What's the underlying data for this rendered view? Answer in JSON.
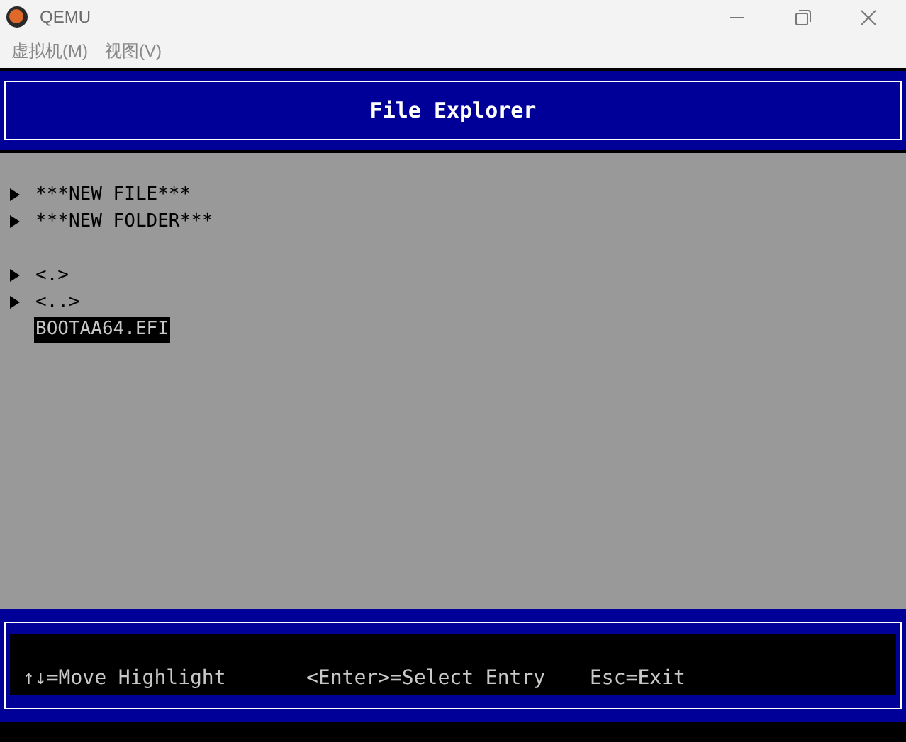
{
  "window": {
    "title": "QEMU"
  },
  "menu": [
    {
      "label": "虚拟机(M)"
    },
    {
      "label": "视图(V)"
    }
  ],
  "screen": {
    "title": "File Explorer",
    "groups": [
      {
        "entries": [
          {
            "label": "***NEW FILE***",
            "arrow": true,
            "selected": false
          },
          {
            "label": "***NEW FOLDER***",
            "arrow": true,
            "selected": false
          }
        ]
      },
      {
        "entries": [
          {
            "label": "<.>",
            "arrow": true,
            "selected": false
          },
          {
            "label": "<..>",
            "arrow": true,
            "selected": false
          },
          {
            "label": "BOOTAA64.EFI",
            "arrow": false,
            "selected": true
          }
        ]
      }
    ],
    "hints": [
      "↑↓=Move Highlight",
      "<Enter>=Select Entry",
      "Esc=Exit"
    ]
  }
}
